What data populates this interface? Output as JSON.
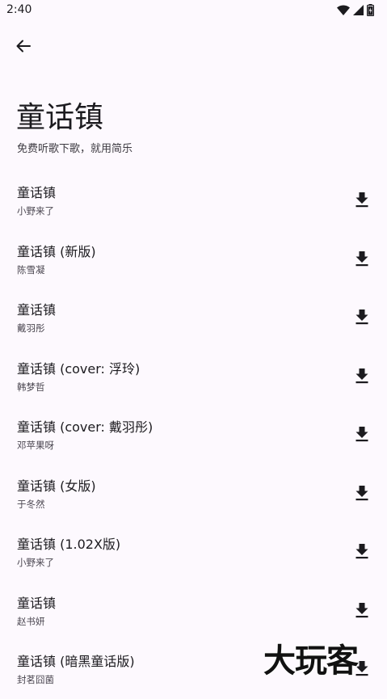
{
  "status_bar": {
    "time": "2:40",
    "icons": [
      "wifi-icon",
      "signal-icon",
      "battery-icon"
    ]
  },
  "header": {
    "back_icon": "arrow-left-icon",
    "title": "童话镇",
    "subtitle": "免费听歌下歌，就用简乐"
  },
  "songs": [
    {
      "title": "童话镇",
      "artist": "小野来了"
    },
    {
      "title": "童话镇 (新版)",
      "artist": "陈雪凝"
    },
    {
      "title": "童话镇",
      "artist": "戴羽彤"
    },
    {
      "title": "童话镇 (cover: 浮玲)",
      "artist": "韩梦哲"
    },
    {
      "title": "童话镇 (cover: 戴羽彤)",
      "artist": "邓苹果呀"
    },
    {
      "title": "童话镇 (女版)",
      "artist": "于冬然"
    },
    {
      "title": "童话镇 (1.02X版)",
      "artist": "小野来了"
    },
    {
      "title": "童话镇",
      "artist": "赵书妍"
    },
    {
      "title": "童话镇 (暗黑童话版)",
      "artist": "封茗囧菌"
    }
  ],
  "watermark": "大玩客",
  "colors": {
    "background": "#fdf9fe",
    "text_primary": "#1c1b1f",
    "text_secondary": "#4a4650"
  }
}
